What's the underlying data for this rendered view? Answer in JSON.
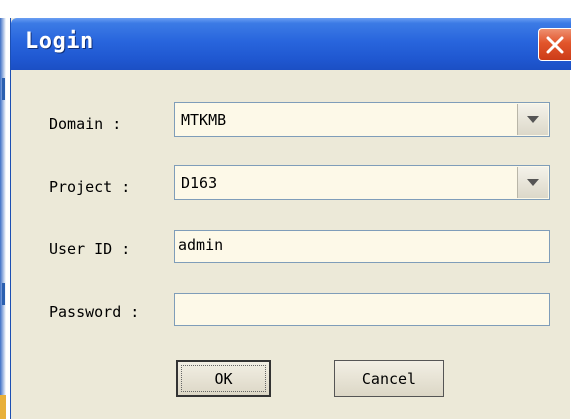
{
  "window": {
    "title": "Login"
  },
  "form": {
    "domain": {
      "label": "Domain :",
      "value": "MTKMB"
    },
    "project": {
      "label": "Project :",
      "value": "D163"
    },
    "user_id": {
      "label": "User ID :",
      "value": "admin"
    },
    "password": {
      "label": "Password :",
      "value": ""
    }
  },
  "buttons": {
    "ok_label": "OK",
    "cancel_label": "Cancel"
  },
  "icons": {
    "close": "close-icon",
    "dropdown": "chevron-down-icon"
  },
  "colors": {
    "titlebar": "#2865dd",
    "close_button": "#e2552b",
    "dialog_background": "#ece9d8",
    "field_background": "#fdf9e8"
  }
}
